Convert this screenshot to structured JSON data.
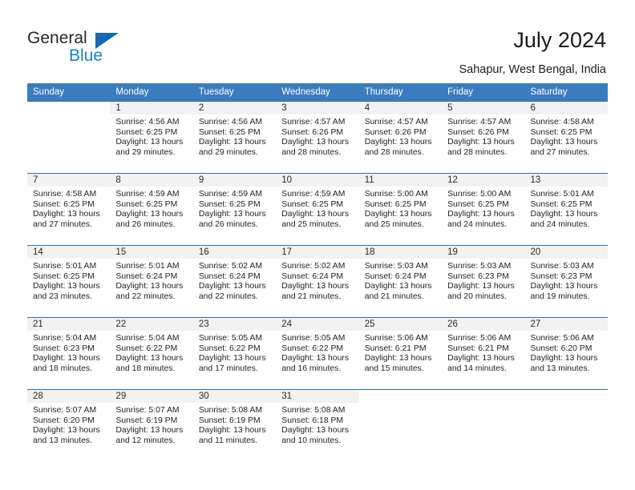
{
  "brand": {
    "name_part1": "General",
    "name_part2": "Blue",
    "triangle_color": "#1668b3",
    "blue_color": "#1a7fd4"
  },
  "header": {
    "title": "July 2024",
    "subtitle": "Sahapur, West Bengal, India"
  },
  "colors": {
    "header_row_bg": "#3a7dbf",
    "header_row_text": "#ffffff",
    "daynum_bg": "#f2f2f2",
    "row_divider": "#2f6ca8"
  },
  "weekdays": [
    "Sunday",
    "Monday",
    "Tuesday",
    "Wednesday",
    "Thursday",
    "Friday",
    "Saturday"
  ],
  "weeks": [
    [
      {
        "day": "",
        "blank": true,
        "sunrise": "",
        "sunset": "",
        "daylight1": "",
        "daylight2": ""
      },
      {
        "day": "1",
        "blank": false,
        "sunrise": "Sunrise: 4:56 AM",
        "sunset": "Sunset: 6:25 PM",
        "daylight1": "Daylight: 13 hours",
        "daylight2": "and 29 minutes."
      },
      {
        "day": "2",
        "blank": false,
        "sunrise": "Sunrise: 4:56 AM",
        "sunset": "Sunset: 6:25 PM",
        "daylight1": "Daylight: 13 hours",
        "daylight2": "and 29 minutes."
      },
      {
        "day": "3",
        "blank": false,
        "sunrise": "Sunrise: 4:57 AM",
        "sunset": "Sunset: 6:26 PM",
        "daylight1": "Daylight: 13 hours",
        "daylight2": "and 28 minutes."
      },
      {
        "day": "4",
        "blank": false,
        "sunrise": "Sunrise: 4:57 AM",
        "sunset": "Sunset: 6:26 PM",
        "daylight1": "Daylight: 13 hours",
        "daylight2": "and 28 minutes."
      },
      {
        "day": "5",
        "blank": false,
        "sunrise": "Sunrise: 4:57 AM",
        "sunset": "Sunset: 6:26 PM",
        "daylight1": "Daylight: 13 hours",
        "daylight2": "and 28 minutes."
      },
      {
        "day": "6",
        "blank": false,
        "sunrise": "Sunrise: 4:58 AM",
        "sunset": "Sunset: 6:25 PM",
        "daylight1": "Daylight: 13 hours",
        "daylight2": "and 27 minutes."
      }
    ],
    [
      {
        "day": "7",
        "blank": false,
        "sunrise": "Sunrise: 4:58 AM",
        "sunset": "Sunset: 6:25 PM",
        "daylight1": "Daylight: 13 hours",
        "daylight2": "and 27 minutes."
      },
      {
        "day": "8",
        "blank": false,
        "sunrise": "Sunrise: 4:59 AM",
        "sunset": "Sunset: 6:25 PM",
        "daylight1": "Daylight: 13 hours",
        "daylight2": "and 26 minutes."
      },
      {
        "day": "9",
        "blank": false,
        "sunrise": "Sunrise: 4:59 AM",
        "sunset": "Sunset: 6:25 PM",
        "daylight1": "Daylight: 13 hours",
        "daylight2": "and 26 minutes."
      },
      {
        "day": "10",
        "blank": false,
        "sunrise": "Sunrise: 4:59 AM",
        "sunset": "Sunset: 6:25 PM",
        "daylight1": "Daylight: 13 hours",
        "daylight2": "and 25 minutes."
      },
      {
        "day": "11",
        "blank": false,
        "sunrise": "Sunrise: 5:00 AM",
        "sunset": "Sunset: 6:25 PM",
        "daylight1": "Daylight: 13 hours",
        "daylight2": "and 25 minutes."
      },
      {
        "day": "12",
        "blank": false,
        "sunrise": "Sunrise: 5:00 AM",
        "sunset": "Sunset: 6:25 PM",
        "daylight1": "Daylight: 13 hours",
        "daylight2": "and 24 minutes."
      },
      {
        "day": "13",
        "blank": false,
        "sunrise": "Sunrise: 5:01 AM",
        "sunset": "Sunset: 6:25 PM",
        "daylight1": "Daylight: 13 hours",
        "daylight2": "and 24 minutes."
      }
    ],
    [
      {
        "day": "14",
        "blank": false,
        "sunrise": "Sunrise: 5:01 AM",
        "sunset": "Sunset: 6:25 PM",
        "daylight1": "Daylight: 13 hours",
        "daylight2": "and 23 minutes."
      },
      {
        "day": "15",
        "blank": false,
        "sunrise": "Sunrise: 5:01 AM",
        "sunset": "Sunset: 6:24 PM",
        "daylight1": "Daylight: 13 hours",
        "daylight2": "and 22 minutes."
      },
      {
        "day": "16",
        "blank": false,
        "sunrise": "Sunrise: 5:02 AM",
        "sunset": "Sunset: 6:24 PM",
        "daylight1": "Daylight: 13 hours",
        "daylight2": "and 22 minutes."
      },
      {
        "day": "17",
        "blank": false,
        "sunrise": "Sunrise: 5:02 AM",
        "sunset": "Sunset: 6:24 PM",
        "daylight1": "Daylight: 13 hours",
        "daylight2": "and 21 minutes."
      },
      {
        "day": "18",
        "blank": false,
        "sunrise": "Sunrise: 5:03 AM",
        "sunset": "Sunset: 6:24 PM",
        "daylight1": "Daylight: 13 hours",
        "daylight2": "and 21 minutes."
      },
      {
        "day": "19",
        "blank": false,
        "sunrise": "Sunrise: 5:03 AM",
        "sunset": "Sunset: 6:23 PM",
        "daylight1": "Daylight: 13 hours",
        "daylight2": "and 20 minutes."
      },
      {
        "day": "20",
        "blank": false,
        "sunrise": "Sunrise: 5:03 AM",
        "sunset": "Sunset: 6:23 PM",
        "daylight1": "Daylight: 13 hours",
        "daylight2": "and 19 minutes."
      }
    ],
    [
      {
        "day": "21",
        "blank": false,
        "sunrise": "Sunrise: 5:04 AM",
        "sunset": "Sunset: 6:23 PM",
        "daylight1": "Daylight: 13 hours",
        "daylight2": "and 18 minutes."
      },
      {
        "day": "22",
        "blank": false,
        "sunrise": "Sunrise: 5:04 AM",
        "sunset": "Sunset: 6:22 PM",
        "daylight1": "Daylight: 13 hours",
        "daylight2": "and 18 minutes."
      },
      {
        "day": "23",
        "blank": false,
        "sunrise": "Sunrise: 5:05 AM",
        "sunset": "Sunset: 6:22 PM",
        "daylight1": "Daylight: 13 hours",
        "daylight2": "and 17 minutes."
      },
      {
        "day": "24",
        "blank": false,
        "sunrise": "Sunrise: 5:05 AM",
        "sunset": "Sunset: 6:22 PM",
        "daylight1": "Daylight: 13 hours",
        "daylight2": "and 16 minutes."
      },
      {
        "day": "25",
        "blank": false,
        "sunrise": "Sunrise: 5:06 AM",
        "sunset": "Sunset: 6:21 PM",
        "daylight1": "Daylight: 13 hours",
        "daylight2": "and 15 minutes."
      },
      {
        "day": "26",
        "blank": false,
        "sunrise": "Sunrise: 5:06 AM",
        "sunset": "Sunset: 6:21 PM",
        "daylight1": "Daylight: 13 hours",
        "daylight2": "and 14 minutes."
      },
      {
        "day": "27",
        "blank": false,
        "sunrise": "Sunrise: 5:06 AM",
        "sunset": "Sunset: 6:20 PM",
        "daylight1": "Daylight: 13 hours",
        "daylight2": "and 13 minutes."
      }
    ],
    [
      {
        "day": "28",
        "blank": false,
        "sunrise": "Sunrise: 5:07 AM",
        "sunset": "Sunset: 6:20 PM",
        "daylight1": "Daylight: 13 hours",
        "daylight2": "and 13 minutes."
      },
      {
        "day": "29",
        "blank": false,
        "sunrise": "Sunrise: 5:07 AM",
        "sunset": "Sunset: 6:19 PM",
        "daylight1": "Daylight: 13 hours",
        "daylight2": "and 12 minutes."
      },
      {
        "day": "30",
        "blank": false,
        "sunrise": "Sunrise: 5:08 AM",
        "sunset": "Sunset: 6:19 PM",
        "daylight1": "Daylight: 13 hours",
        "daylight2": "and 11 minutes."
      },
      {
        "day": "31",
        "blank": false,
        "sunrise": "Sunrise: 5:08 AM",
        "sunset": "Sunset: 6:18 PM",
        "daylight1": "Daylight: 13 hours",
        "daylight2": "and 10 minutes."
      },
      {
        "day": "",
        "blank": true,
        "sunrise": "",
        "sunset": "",
        "daylight1": "",
        "daylight2": ""
      },
      {
        "day": "",
        "blank": true,
        "sunrise": "",
        "sunset": "",
        "daylight1": "",
        "daylight2": ""
      },
      {
        "day": "",
        "blank": true,
        "sunrise": "",
        "sunset": "",
        "daylight1": "",
        "daylight2": ""
      }
    ]
  ]
}
